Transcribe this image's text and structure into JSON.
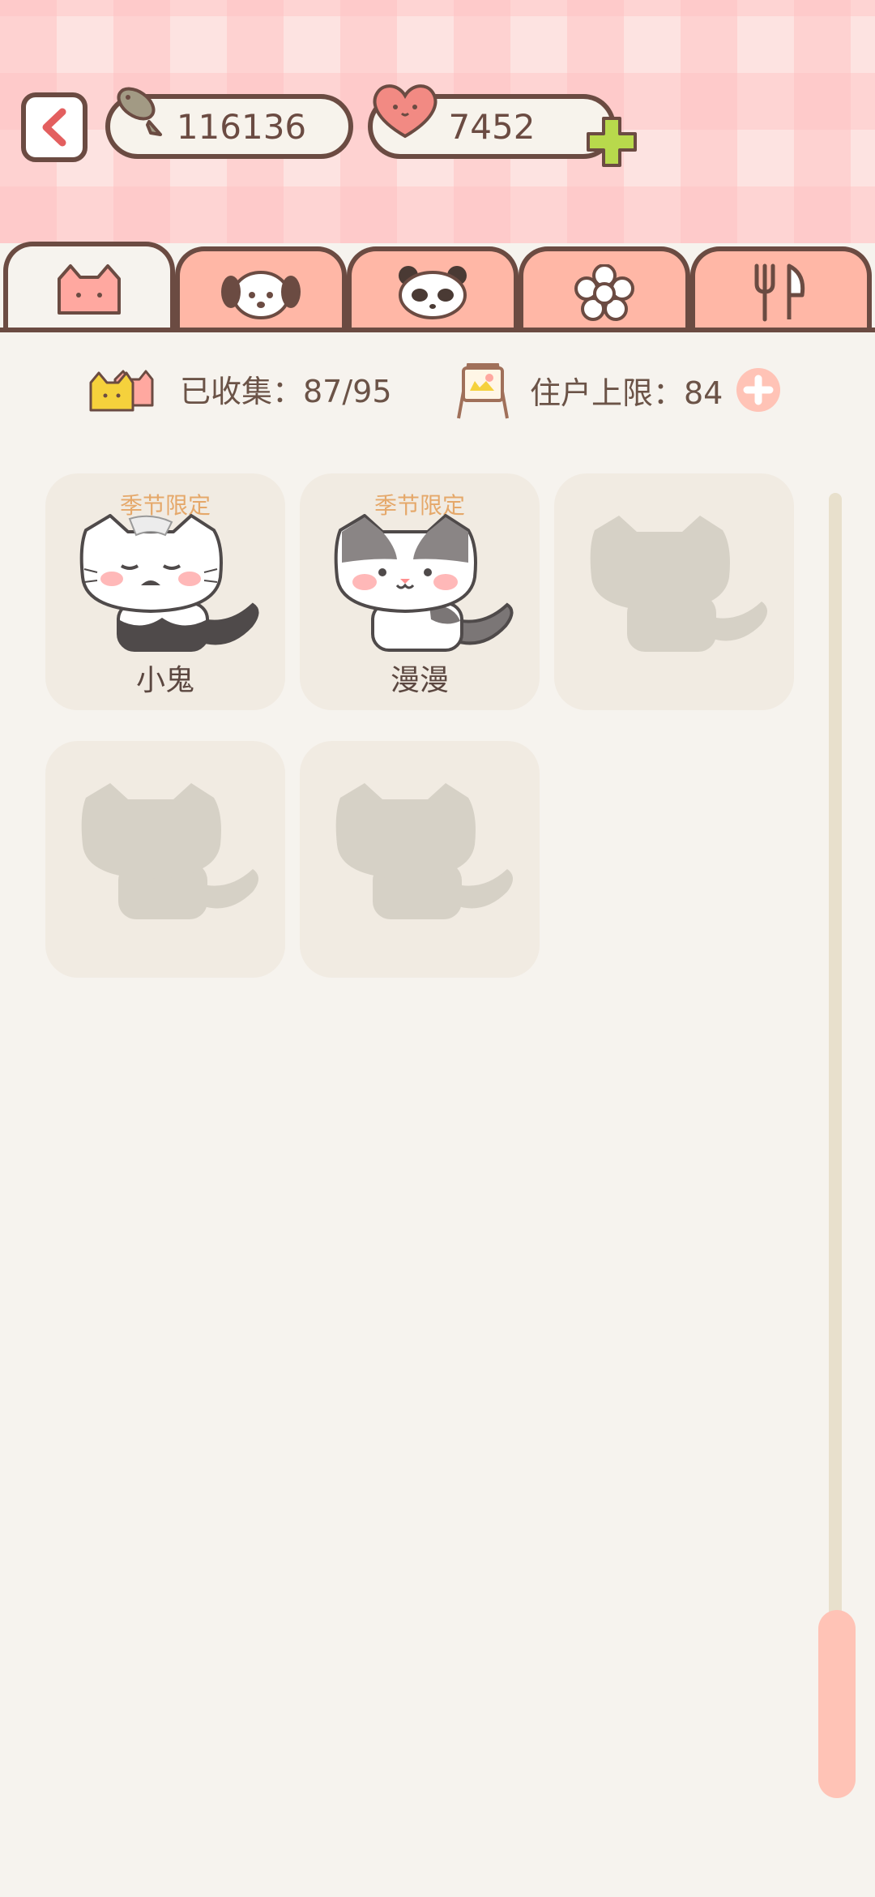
{
  "currency": {
    "fish_amount": "116136",
    "heart_amount": "7452"
  },
  "tabs": [
    {
      "icon": "cat-face-icon",
      "active": true
    },
    {
      "icon": "dog-face-icon",
      "active": false
    },
    {
      "icon": "panda-face-icon",
      "active": false
    },
    {
      "icon": "flower-icon",
      "active": false
    },
    {
      "icon": "fork-knife-icon",
      "active": false
    }
  ],
  "stats": {
    "collected_label": "已收集：87/95",
    "limit_label": "住户上限：84"
  },
  "cards": [
    {
      "tag": "季节限定",
      "name": "小鬼",
      "locked": false
    },
    {
      "tag": "季节限定",
      "name": "漫漫",
      "locked": false
    },
    {
      "tag": "",
      "name": "",
      "locked": true
    },
    {
      "tag": "",
      "name": "",
      "locked": true
    },
    {
      "tag": "",
      "name": "",
      "locked": true
    }
  ],
  "colors": {
    "accent": "#ffb7a6",
    "outline": "#6b4b42",
    "tag": "#e5a86a",
    "background": "#f6f3ee",
    "plus": "#b8d94c"
  }
}
